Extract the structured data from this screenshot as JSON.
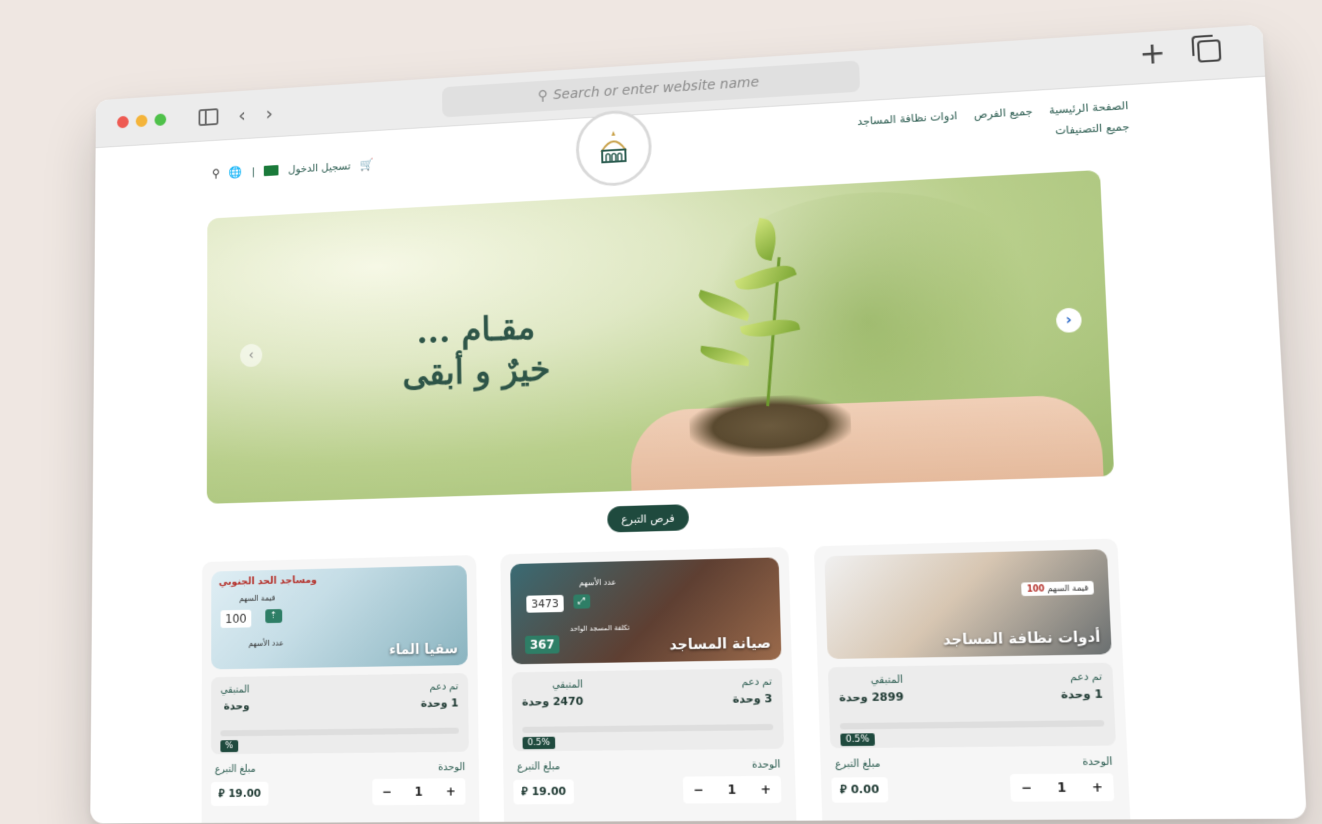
{
  "browser": {
    "url_placeholder": "Search or enter website name"
  },
  "site": {
    "nav": {
      "home": "الصفحة الرئيسية",
      "all_opportunities": "جميع الفرص",
      "cleaning_tools": "ادوات نظافة المساجد",
      "all_categories": "جميع التصنيفات"
    },
    "login": "تسجيل الدخول",
    "lang_sep": "|"
  },
  "hero": {
    "line1": "مقـام ...",
    "line2": "خيرٌ و أبقى"
  },
  "section_button": "فرص التبرع",
  "cards": [
    {
      "title": "سقيا الماء",
      "banner_line": "ومساجد الحد الجنوبي",
      "share_label": "قيمة السهم",
      "share_value": "100",
      "count_label": "عدد الأسهم",
      "supported_label": "تم دعم",
      "supported_value": "1 وحدة",
      "remaining_label": "المتبقي",
      "remaining_value": "وحدة",
      "percent": "%",
      "unit_label": "الوحدة",
      "amount_label": "مبلغ التبرع",
      "amount_value": "19.00",
      "qty": "1"
    },
    {
      "title": "صيانة المساجد",
      "banner_line": "عدد الأسهم",
      "share_label": "تكلفة المسجد الواحد",
      "share_value": "367",
      "count_value": "3473",
      "supported_label": "تم دعم",
      "supported_value": "3 وحدة",
      "remaining_label": "المتبقي",
      "remaining_value": "2470 وحدة",
      "percent": "0.5%",
      "unit_label": "الوحدة",
      "amount_label": "مبلغ التبرع",
      "amount_value": "19.00",
      "qty": "1"
    },
    {
      "title": "أدوات نظافة المساجد",
      "share_label": "قيمة السهم",
      "share_value": "100",
      "supported_label": "تم دعم",
      "supported_value": "1 وحدة",
      "remaining_label": "المتبقي",
      "remaining_value": "2899 وحدة",
      "percent": "0.5%",
      "unit_label": "الوحدة",
      "amount_label": "مبلغ التبرع",
      "amount_value": "0.00",
      "qty": "1"
    }
  ],
  "stepper": {
    "minus": "−",
    "plus": "+"
  },
  "currency_symbol": "⃁",
  "colors": {
    "primary": "#1f4a3e",
    "accent_text": "#2a5b4f"
  }
}
